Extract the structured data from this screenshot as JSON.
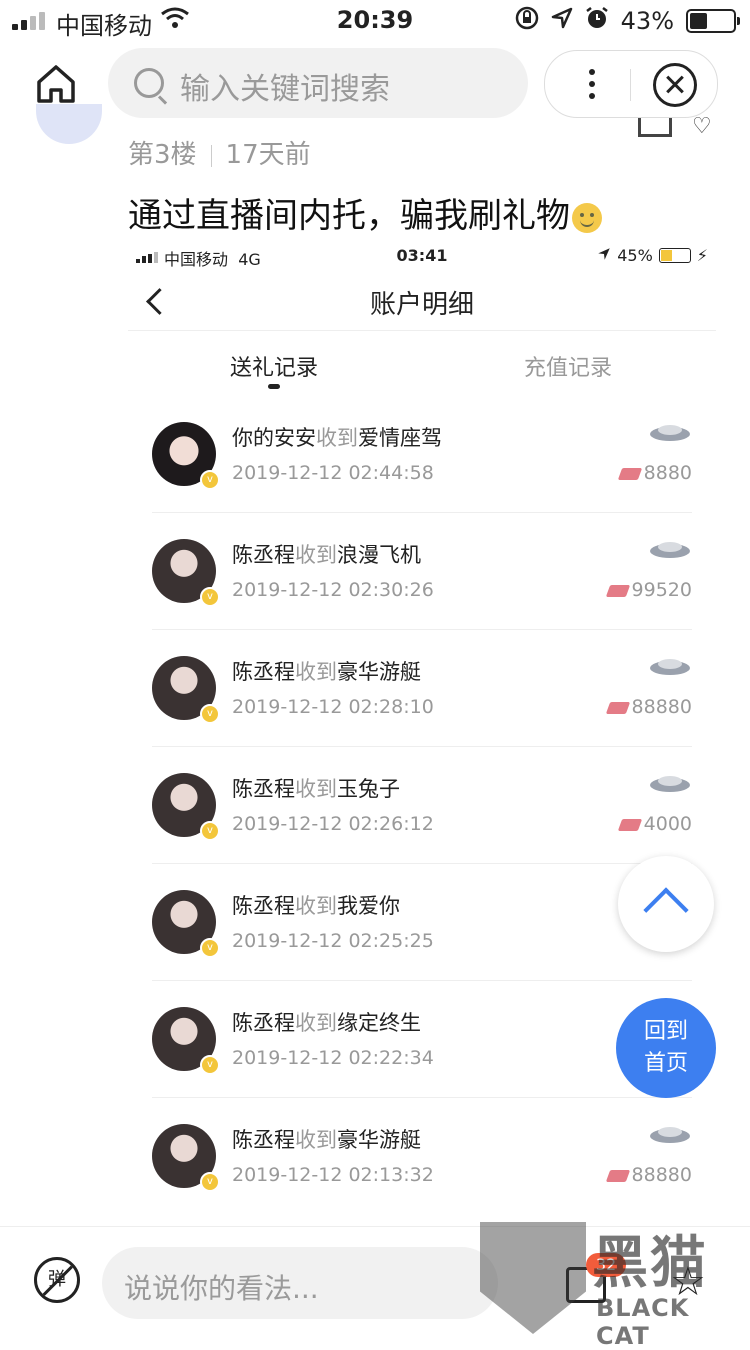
{
  "status_bar": {
    "carrier": "中国移动",
    "time": "20:39",
    "battery": "43%",
    "battery_level": 0.43
  },
  "search": {
    "placeholder": "输入关键词搜索"
  },
  "post": {
    "floor": "第3楼",
    "ago": "17天前",
    "title": "通过直播间内托，骗我刷礼物"
  },
  "embedded": {
    "status": {
      "carrier": "中国移动",
      "network": "4G",
      "time": "03:41",
      "battery": "45%",
      "battery_level": 0.45
    },
    "title": "账户明细",
    "tabs": [
      {
        "label": "送礼记录",
        "active": true
      },
      {
        "label": "充值记录",
        "active": false
      }
    ],
    "records": [
      {
        "name": "你的安安",
        "action": "收到",
        "gift": "爱情座驾",
        "time": "2019-12-12 02:44:58",
        "amount": "8880",
        "icon": "sports-car-icon"
      },
      {
        "name": "陈丞程",
        "action": "收到",
        "gift": "浪漫飞机",
        "time": "2019-12-12 02:30:26",
        "amount": "99520",
        "icon": "airplane-icon"
      },
      {
        "name": "陈丞程",
        "action": "收到",
        "gift": "豪华游艇",
        "time": "2019-12-12 02:28:10",
        "amount": "88880",
        "icon": "yacht-icon"
      },
      {
        "name": "陈丞程",
        "action": "收到",
        "gift": "玉兔子",
        "time": "2019-12-12 02:26:12",
        "amount": "4000",
        "icon": "rabbit-icon"
      },
      {
        "name": "陈丞程",
        "action": "收到",
        "gift": "我爱你",
        "time": "2019-12-12 02:25:25",
        "amount": "",
        "icon": "gift-icon"
      },
      {
        "name": "陈丞程",
        "action": "收到",
        "gift": "缘定终生",
        "time": "2019-12-12 02:22:34",
        "amount": "",
        "icon": "gift-icon"
      },
      {
        "name": "陈丞程",
        "action": "收到",
        "gift": "豪华游艇",
        "time": "2019-12-12 02:13:32",
        "amount": "88880",
        "icon": "yacht-icon"
      }
    ]
  },
  "float": {
    "home_line1": "回到",
    "home_line2": "首页"
  },
  "comment": {
    "placeholder": "说说你的看法...",
    "badge": "32",
    "danmu": "弹"
  },
  "watermark": {
    "brand_cn": "黑猫",
    "brand_en": "BLACK CAT"
  }
}
